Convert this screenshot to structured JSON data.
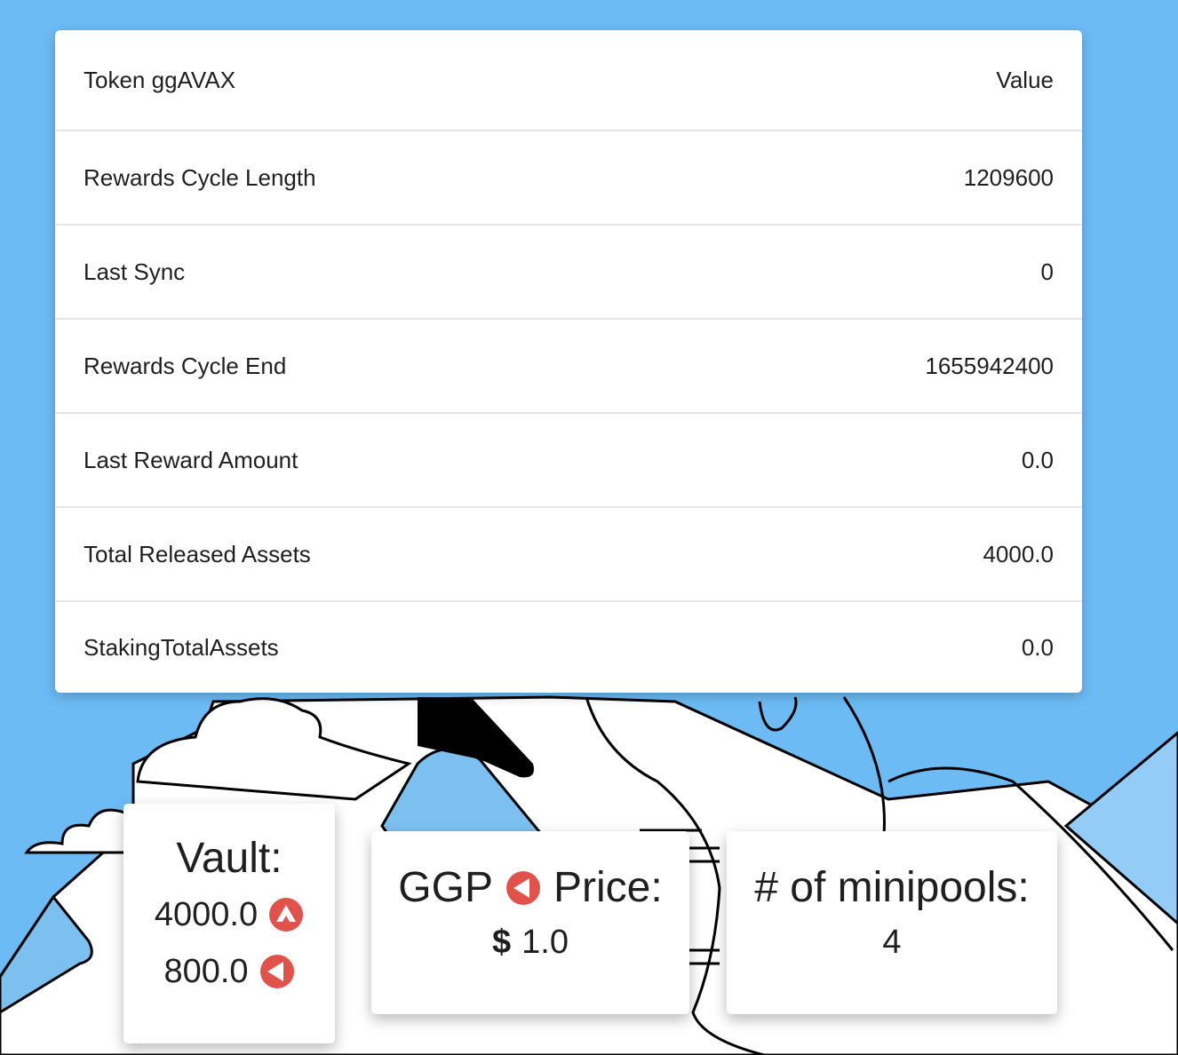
{
  "table": {
    "header": {
      "label": "Token ggAVAX",
      "value": "Value"
    },
    "rows": [
      {
        "label": "Rewards Cycle Length",
        "value": "1209600"
      },
      {
        "label": "Last Sync",
        "value": "0"
      },
      {
        "label": "Rewards Cycle End",
        "value": "1655942400"
      },
      {
        "label": "Last Reward Amount",
        "value": "0.0"
      },
      {
        "label": "Total Released Assets",
        "value": "4000.0"
      },
      {
        "label": "StakingTotalAssets",
        "value": "0.0"
      }
    ]
  },
  "vault": {
    "title": "Vault:",
    "avax_amount": "4000.0",
    "avax_icon": "avax-icon",
    "ggp_amount": "800.0",
    "ggp_icon": "ggp-icon"
  },
  "price": {
    "title_prefix": "GGP",
    "title_suffix": "Price:",
    "currency": "$",
    "value": "1.0",
    "icon": "ggp-icon"
  },
  "minipools": {
    "title": "# of minipools:",
    "count": "4"
  },
  "colors": {
    "background": "#6cbbf5",
    "icon_red": "#e0524a",
    "card": "#ffffff"
  }
}
